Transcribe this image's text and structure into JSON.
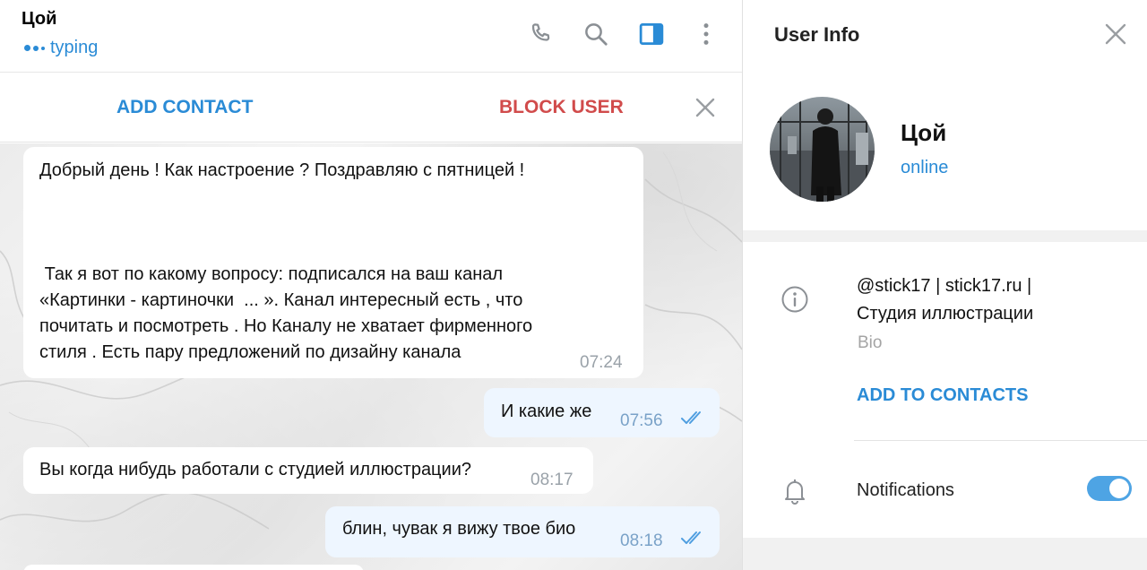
{
  "chat": {
    "title": "Цой",
    "status": "typing",
    "header_icons": [
      "phone-icon",
      "search-icon",
      "sidebar-toggle-icon",
      "more-vertical-icon"
    ],
    "actions": {
      "add_contact": "ADD CONTACT",
      "block_user": "BLOCK USER"
    },
    "messages": [
      {
        "direction": "in",
        "text": "Добрый день ! Как настроение ? Поздравляю с пятницей !\n\n\n\n Так я вот по какому вопросу: подписался на ваш канал\n«Картинки - картиночки  ... ». Канал интересный есть , что\nпочитать и посмотреть . Но Каналу не хватает фирменного\nстиля . Есть пару предложений по дизайну канала",
        "time": "07:24"
      },
      {
        "direction": "out",
        "text": "И какие же",
        "time": "07:56",
        "read": true
      },
      {
        "direction": "in",
        "text": "Вы когда нибудь работали с студией иллюстрации?",
        "time": "08:17"
      },
      {
        "direction": "out",
        "text": "блин, чувак я вижу твое био",
        "time": "08:18",
        "read": true
      }
    ]
  },
  "info": {
    "title": "User Info",
    "name": "Цой",
    "status": "online",
    "bio": "@stick17 | stick17.ru |\nСтудия иллюстрации",
    "bio_label": "Bio",
    "add_to_contacts": "ADD TO CONTACTS",
    "notifications_label": "Notifications",
    "notifications_enabled": true
  },
  "colors": {
    "accent": "#2a8bd6",
    "danger": "#d14b4b",
    "toggle": "#4ea4e4"
  }
}
